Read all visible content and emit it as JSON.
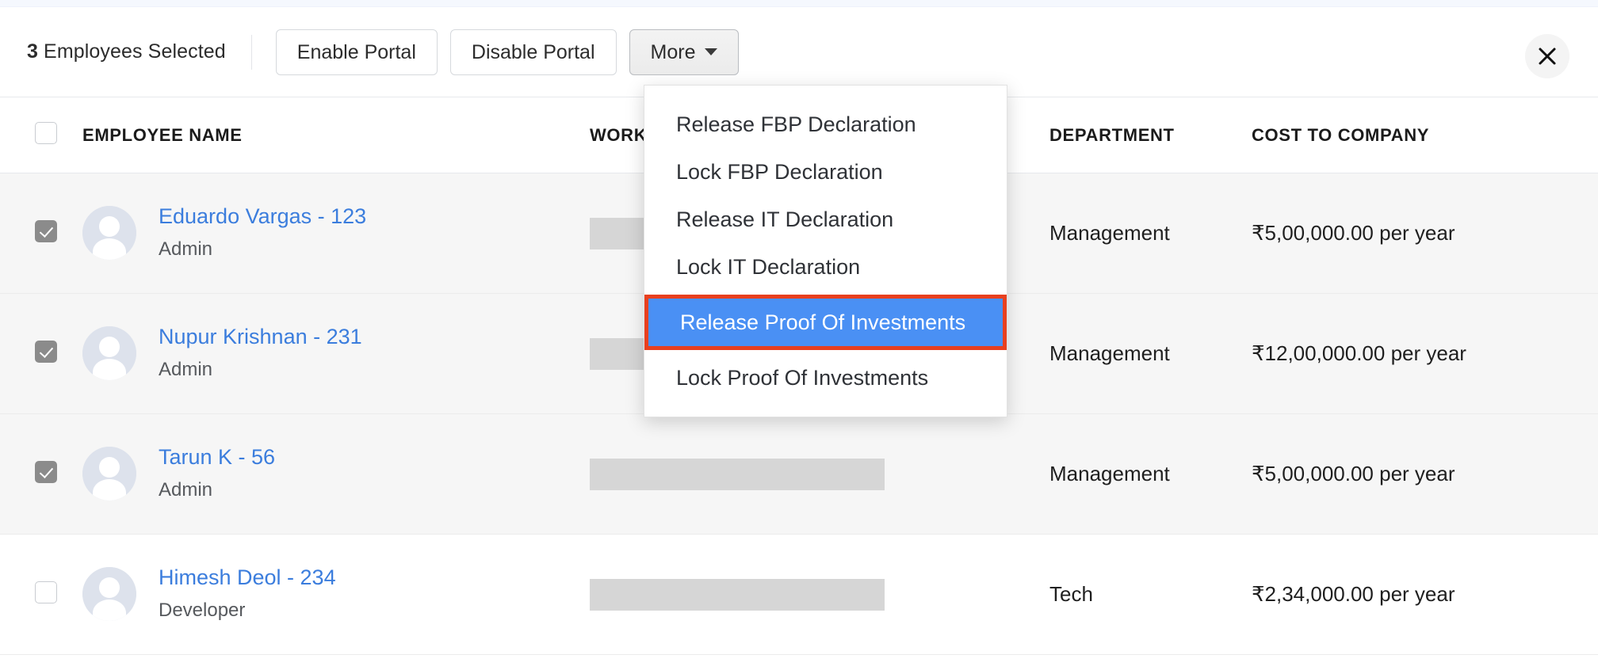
{
  "toolbar": {
    "selection_count": "3",
    "selection_label": " Employees Selected",
    "buttons": [
      {
        "label": "Enable Portal",
        "name": "enable-portal-button",
        "active": false
      },
      {
        "label": "Disable Portal",
        "name": "disable-portal-button",
        "active": false
      },
      {
        "label": "More",
        "name": "more-button",
        "active": true
      }
    ],
    "close_icon": "close-icon"
  },
  "dropdown": {
    "items": [
      {
        "label": "Release FBP Declaration",
        "highlighted": false
      },
      {
        "label": "Lock FBP Declaration",
        "highlighted": false
      },
      {
        "label": "Release IT Declaration",
        "highlighted": false
      },
      {
        "label": "Lock IT Declaration",
        "highlighted": false
      },
      {
        "label": "Release Proof Of Investments",
        "highlighted": true
      },
      {
        "label": "Lock Proof Of Investments",
        "highlighted": false
      }
    ],
    "highlight_color": "#4a90f4",
    "annotation_box_color": "#e8401f"
  },
  "table": {
    "columns": [
      {
        "key": "employee_name",
        "label": "EMPLOYEE NAME"
      },
      {
        "key": "work",
        "label": "WORK"
      },
      {
        "key": "department",
        "label": "DEPARTMENT"
      },
      {
        "key": "cost_to_company",
        "label": "COST TO COMPANY"
      }
    ],
    "header_checkbox_checked": false,
    "rows": [
      {
        "checked": true,
        "name": "Eduardo Vargas - 123",
        "role": "Admin",
        "work": "",
        "work_redacted": true,
        "department": "Management",
        "cost_to_company": "₹5,00,000.00 per year"
      },
      {
        "checked": true,
        "name": "Nupur Krishnan - 231",
        "role": "Admin",
        "work": "",
        "work_redacted": true,
        "department": "Management",
        "cost_to_company": "₹12,00,000.00 per year"
      },
      {
        "checked": true,
        "name": "Tarun K - 56",
        "role": "Admin",
        "work": "",
        "work_redacted": true,
        "department": "Management",
        "cost_to_company": "₹5,00,000.00 per year"
      },
      {
        "checked": false,
        "name": "Himesh Deol - 234",
        "role": "Developer",
        "work": "",
        "work_redacted": true,
        "department": "Tech",
        "cost_to_company": "₹2,34,000.00 per year"
      }
    ]
  },
  "colors": {
    "link": "#3b7ddd",
    "selected_row_bg": "#f6f6f6",
    "accent_highlight": "#4a90f4",
    "annotation": "#e8401f"
  }
}
